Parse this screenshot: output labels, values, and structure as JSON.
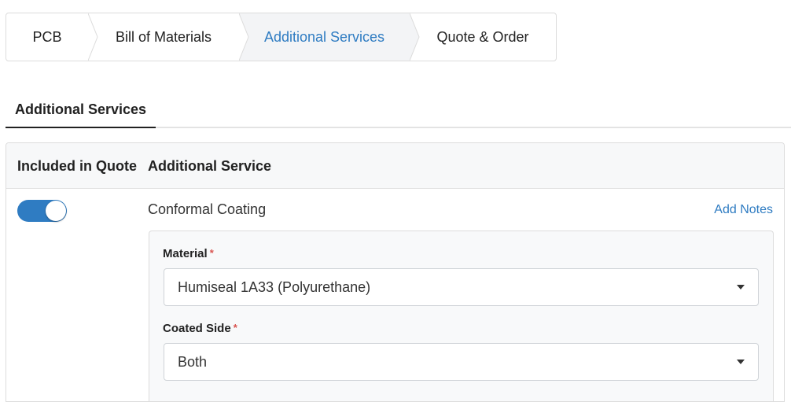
{
  "stepper": {
    "steps": [
      {
        "label": "PCB",
        "active": false
      },
      {
        "label": "Bill of Materials",
        "active": false
      },
      {
        "label": "Additional Services",
        "active": true
      },
      {
        "label": "Quote & Order",
        "active": false
      }
    ]
  },
  "tabs": [
    {
      "label": "Additional Services",
      "active": true
    }
  ],
  "table": {
    "headers": [
      "Included in Quote",
      "Additional Service"
    ],
    "rows": [
      {
        "included": true,
        "service": "Conformal Coating",
        "notes_link": "Add Notes",
        "fields": [
          {
            "label": "Material",
            "required_mark": "*",
            "value": "Humiseal 1A33 (Polyurethane)"
          },
          {
            "label": "Coated Side",
            "required_mark": "*",
            "value": "Both"
          }
        ]
      }
    ]
  },
  "colors": {
    "accent": "#2f7cc2",
    "required": "#d9534f",
    "active_step_bg": "#f3f4f6",
    "header_bg": "#f7f8f9"
  },
  "icons": {
    "step_separator": "chevron-right-icon",
    "select_caret": "caret-down-icon"
  }
}
